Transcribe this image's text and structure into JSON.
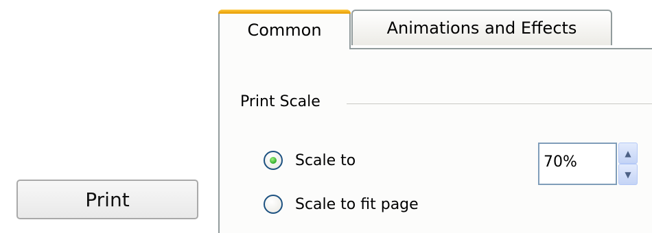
{
  "print_button": {
    "label": "Print"
  },
  "tabs": [
    {
      "label": "Common",
      "selected": true
    },
    {
      "label": "Animations and Effects",
      "selected": false
    }
  ],
  "print_scale": {
    "group_label": "Print Scale",
    "options": [
      {
        "label": "Scale to",
        "checked": true
      },
      {
        "label": "Scale to fit page",
        "checked": false
      }
    ],
    "scale_value": "70%"
  },
  "icons": {
    "spinner_up": "triangle-up",
    "spinner_down": "triangle-down"
  },
  "colors": {
    "selected_tab_accent": "#e69b00",
    "radio_checked_dot": "#21a121",
    "border": "#919b9c"
  }
}
